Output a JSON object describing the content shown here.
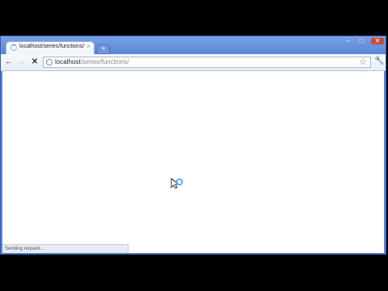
{
  "tab": {
    "title": "localhost/series/functions/",
    "close_label": "×"
  },
  "newtab_label": "+",
  "window_controls": {
    "minimize": "–",
    "maximize": "□",
    "close": "✕"
  },
  "nav": {
    "back": "←",
    "forward": "→",
    "stop": "✕"
  },
  "omnibox": {
    "host": "localhost",
    "path": "/series/functions/"
  },
  "status": {
    "text": "Sending request..."
  },
  "icons": [
    "loading-spinner-icon",
    "back-arrow-icon",
    "forward-arrow-icon",
    "stop-icon",
    "page-icon",
    "star-icon",
    "wrench-icon",
    "busy-cursor-icon"
  ]
}
